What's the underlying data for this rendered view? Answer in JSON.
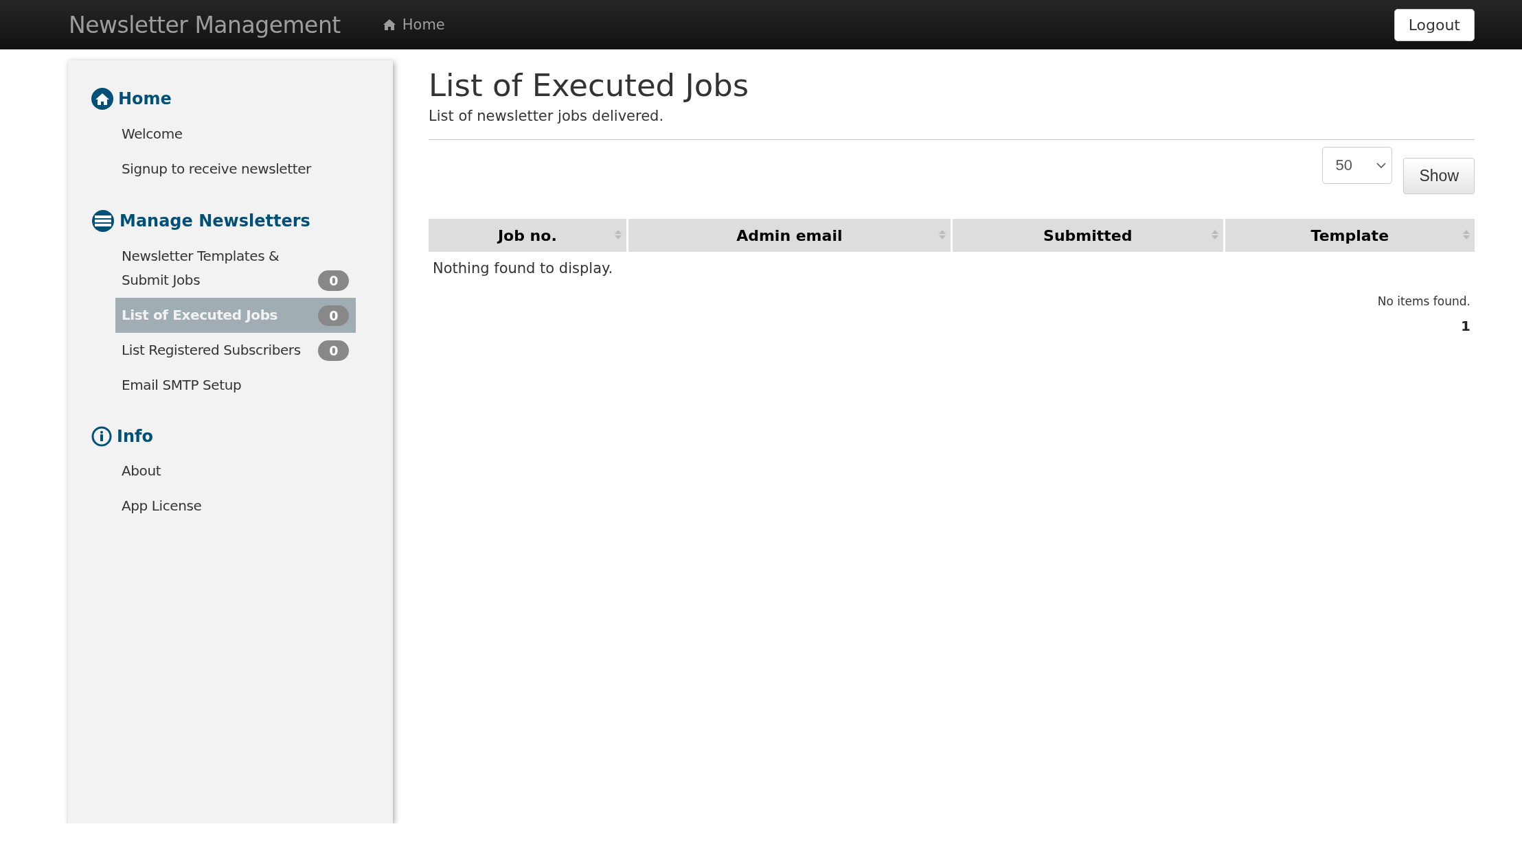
{
  "navbar": {
    "brand": "Newsletter Management",
    "links": [
      {
        "label": "Home"
      }
    ],
    "logout": "Logout"
  },
  "sidebar": {
    "sections": [
      {
        "title": "Home",
        "items": [
          {
            "label": "Welcome",
            "selected": false
          },
          {
            "label": "Signup to receive newsletter",
            "selected": false
          }
        ]
      },
      {
        "title": "Manage Newsletters",
        "items": [
          {
            "label": "Newsletter Templates & Submit Jobs",
            "badge": "0",
            "selected": false
          },
          {
            "label": "List of Executed Jobs",
            "badge": "0",
            "selected": true
          },
          {
            "label": "List Registered Subscribers",
            "badge": "0",
            "selected": false
          },
          {
            "label": "Email SMTP Setup",
            "selected": false
          }
        ]
      },
      {
        "title": "Info",
        "items": [
          {
            "label": "About",
            "selected": false
          },
          {
            "label": "App License",
            "selected": false
          }
        ]
      }
    ]
  },
  "main": {
    "title": "List of Executed Jobs",
    "subtitle": "List of newsletter jobs delivered.",
    "page_size": "50",
    "show_button": "Show",
    "table": {
      "columns": [
        "Job no.",
        "Admin email",
        "Submitted",
        "Template"
      ],
      "empty_message": "Nothing found to display."
    },
    "status": "No items found.",
    "pages": [
      {
        "label": "1",
        "selected": true
      }
    ]
  }
}
